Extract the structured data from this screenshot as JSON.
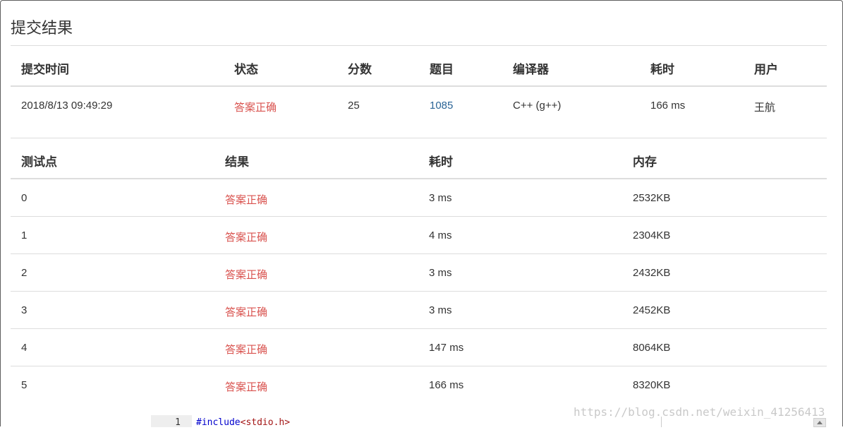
{
  "page": {
    "title": "提交结果"
  },
  "submission": {
    "headers": [
      "提交时间",
      "状态",
      "分数",
      "题目",
      "编译器",
      "耗时",
      "用户"
    ],
    "row": {
      "time": "2018/8/13 09:49:29",
      "status": "答案正确",
      "score": "25",
      "problem": "1085",
      "compiler": "C++ (g++)",
      "elapsed": "166 ms",
      "user": "王航"
    }
  },
  "testcases": {
    "headers": [
      "测试点",
      "结果",
      "耗时",
      "内存"
    ],
    "rows": [
      {
        "id": "0",
        "result": "答案正确",
        "time": "3 ms",
        "memory": "2532KB"
      },
      {
        "id": "1",
        "result": "答案正确",
        "time": "4 ms",
        "memory": "2304KB"
      },
      {
        "id": "2",
        "result": "答案正确",
        "time": "3 ms",
        "memory": "2432KB"
      },
      {
        "id": "3",
        "result": "答案正确",
        "time": "3 ms",
        "memory": "2452KB"
      },
      {
        "id": "4",
        "result": "答案正确",
        "time": "147 ms",
        "memory": "8064KB"
      },
      {
        "id": "5",
        "result": "答案正确",
        "time": "166 ms",
        "memory": "8320KB"
      }
    ]
  },
  "code": {
    "line_number": "1",
    "directive": "#include",
    "header": "<stdio.h>"
  },
  "watermark": "https://blog.csdn.net/weixin_41256413",
  "colors": {
    "accepted": "#d9534f",
    "link": "#2a6496",
    "rule": "#dddddd"
  }
}
